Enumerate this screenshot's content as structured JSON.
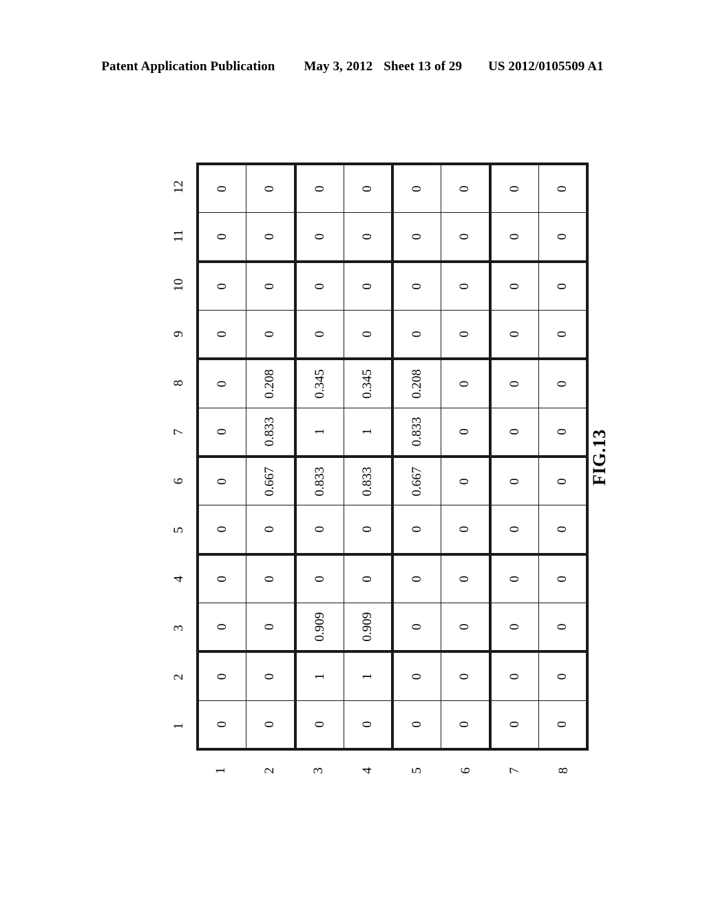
{
  "header": {
    "publication": "Patent Application Publication",
    "date": "May 3, 2012",
    "sheet": "Sheet 13 of 29",
    "patent_number": "US 2012/0105509 A1"
  },
  "figure": {
    "caption": "FIG.13",
    "orientation": "rotated-90-ccw",
    "row_header_label": "",
    "column_header_label": ""
  },
  "chart_data": {
    "type": "table",
    "title": "FIG.13",
    "description": "8 x 12 similarity matrix",
    "row_labels": [
      "1",
      "2",
      "3",
      "4",
      "5",
      "6",
      "7",
      "8"
    ],
    "column_labels": [
      "1",
      "2",
      "3",
      "4",
      "5",
      "6",
      "7",
      "8",
      "9",
      "10",
      "11",
      "12"
    ],
    "values": [
      [
        "0",
        "0",
        "0",
        "0",
        "0",
        "0",
        "0",
        "0",
        "0",
        "0",
        "0",
        "0"
      ],
      [
        "0",
        "0",
        "0",
        "0",
        "0",
        "0.667",
        "0.833",
        "0.208",
        "0",
        "0",
        "0",
        "0"
      ],
      [
        "0",
        "1",
        "0.909",
        "0",
        "0",
        "0.833",
        "1",
        "0.345",
        "0",
        "0",
        "0",
        "0"
      ],
      [
        "0",
        "1",
        "0.909",
        "0",
        "0",
        "0.833",
        "1",
        "0.345",
        "0",
        "0",
        "0",
        "0"
      ],
      [
        "0",
        "0",
        "0",
        "0",
        "0",
        "0.667",
        "0.833",
        "0.208",
        "0",
        "0",
        "0",
        "0"
      ],
      [
        "0",
        "0",
        "0",
        "0",
        "0",
        "0",
        "0",
        "0",
        "0",
        "0",
        "0",
        "0"
      ],
      [
        "0",
        "0",
        "0",
        "0",
        "0",
        "0",
        "0",
        "0",
        "0",
        "0",
        "0",
        "0"
      ],
      [
        "0",
        "0",
        "0",
        "0",
        "0",
        "0",
        "0",
        "0",
        "0",
        "0",
        "0",
        "0"
      ]
    ],
    "row_group_breaks": [
      2,
      4,
      6
    ],
    "column_group_breaks": [
      2,
      4,
      6,
      8,
      10
    ],
    "grid": true,
    "xlabel": "",
    "ylabel": ""
  },
  "colors": {
    "ink": "#000000",
    "grid_line": "#1a1a1a",
    "page_background": "#ffffff"
  }
}
